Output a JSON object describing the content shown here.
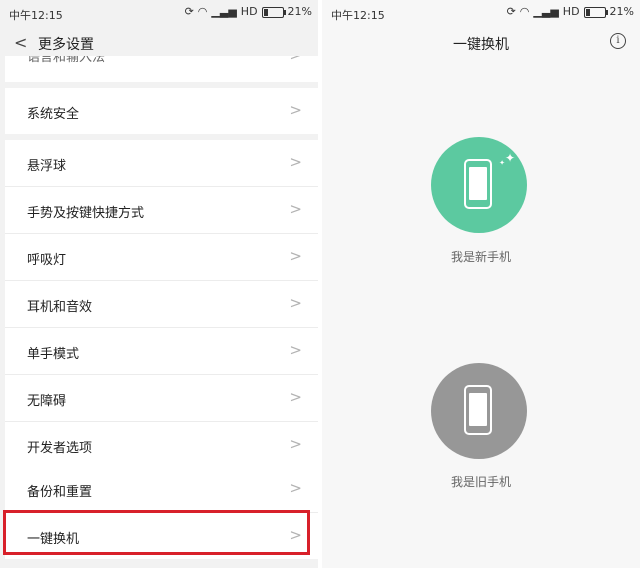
{
  "left_screen": {
    "status": {
      "time": "中午12:15",
      "network": "HD",
      "battery": "21%"
    },
    "header": {
      "title": "更多设置"
    },
    "partial_item": "语言和输入法",
    "groups": [
      [
        "系统安全"
      ],
      [
        "悬浮球",
        "手势及按键快捷方式",
        "呼吸灯",
        "耳机和音效",
        "单手模式",
        "无障碍",
        "开发者选项"
      ],
      [
        "备份和重置",
        "一键换机"
      ]
    ]
  },
  "right_screen": {
    "status": {
      "time": "中午12:15",
      "network": "HD",
      "battery": "21%"
    },
    "header": {
      "title": "一键换机"
    },
    "options": [
      {
        "label": "我是新手机",
        "color": "#5cc9a0"
      },
      {
        "label": "我是旧手机",
        "color": "#979797"
      }
    ]
  }
}
